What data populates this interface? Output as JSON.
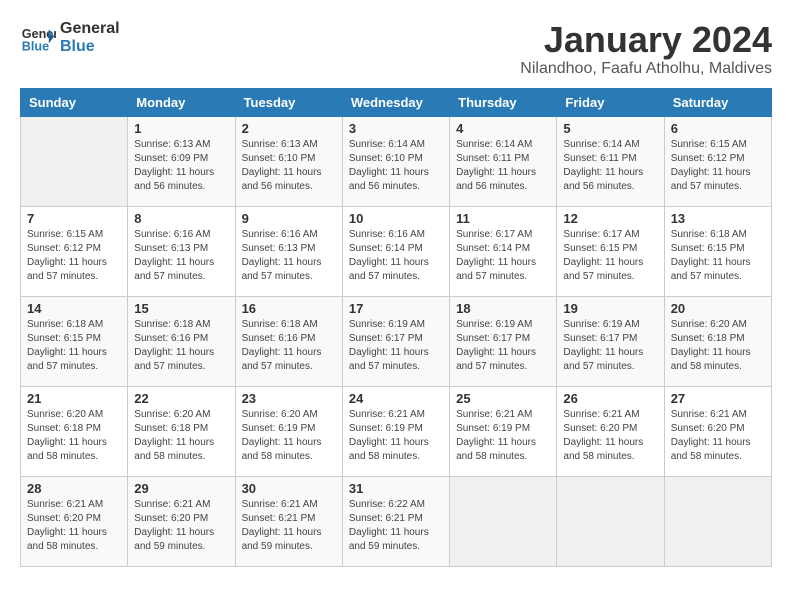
{
  "header": {
    "logo_line1": "General",
    "logo_line2": "Blue",
    "month": "January 2024",
    "location": "Nilandhoo, Faafu Atholhu, Maldives"
  },
  "weekdays": [
    "Sunday",
    "Monday",
    "Tuesday",
    "Wednesday",
    "Thursday",
    "Friday",
    "Saturday"
  ],
  "weeks": [
    [
      {
        "day": "",
        "info": ""
      },
      {
        "day": "1",
        "info": "Sunrise: 6:13 AM\nSunset: 6:09 PM\nDaylight: 11 hours\nand 56 minutes."
      },
      {
        "day": "2",
        "info": "Sunrise: 6:13 AM\nSunset: 6:10 PM\nDaylight: 11 hours\nand 56 minutes."
      },
      {
        "day": "3",
        "info": "Sunrise: 6:14 AM\nSunset: 6:10 PM\nDaylight: 11 hours\nand 56 minutes."
      },
      {
        "day": "4",
        "info": "Sunrise: 6:14 AM\nSunset: 6:11 PM\nDaylight: 11 hours\nand 56 minutes."
      },
      {
        "day": "5",
        "info": "Sunrise: 6:14 AM\nSunset: 6:11 PM\nDaylight: 11 hours\nand 56 minutes."
      },
      {
        "day": "6",
        "info": "Sunrise: 6:15 AM\nSunset: 6:12 PM\nDaylight: 11 hours\nand 57 minutes."
      }
    ],
    [
      {
        "day": "7",
        "info": "Sunrise: 6:15 AM\nSunset: 6:12 PM\nDaylight: 11 hours\nand 57 minutes."
      },
      {
        "day": "8",
        "info": "Sunrise: 6:16 AM\nSunset: 6:13 PM\nDaylight: 11 hours\nand 57 minutes."
      },
      {
        "day": "9",
        "info": "Sunrise: 6:16 AM\nSunset: 6:13 PM\nDaylight: 11 hours\nand 57 minutes."
      },
      {
        "day": "10",
        "info": "Sunrise: 6:16 AM\nSunset: 6:14 PM\nDaylight: 11 hours\nand 57 minutes."
      },
      {
        "day": "11",
        "info": "Sunrise: 6:17 AM\nSunset: 6:14 PM\nDaylight: 11 hours\nand 57 minutes."
      },
      {
        "day": "12",
        "info": "Sunrise: 6:17 AM\nSunset: 6:15 PM\nDaylight: 11 hours\nand 57 minutes."
      },
      {
        "day": "13",
        "info": "Sunrise: 6:18 AM\nSunset: 6:15 PM\nDaylight: 11 hours\nand 57 minutes."
      }
    ],
    [
      {
        "day": "14",
        "info": "Sunrise: 6:18 AM\nSunset: 6:15 PM\nDaylight: 11 hours\nand 57 minutes."
      },
      {
        "day": "15",
        "info": "Sunrise: 6:18 AM\nSunset: 6:16 PM\nDaylight: 11 hours\nand 57 minutes."
      },
      {
        "day": "16",
        "info": "Sunrise: 6:18 AM\nSunset: 6:16 PM\nDaylight: 11 hours\nand 57 minutes."
      },
      {
        "day": "17",
        "info": "Sunrise: 6:19 AM\nSunset: 6:17 PM\nDaylight: 11 hours\nand 57 minutes."
      },
      {
        "day": "18",
        "info": "Sunrise: 6:19 AM\nSunset: 6:17 PM\nDaylight: 11 hours\nand 57 minutes."
      },
      {
        "day": "19",
        "info": "Sunrise: 6:19 AM\nSunset: 6:17 PM\nDaylight: 11 hours\nand 57 minutes."
      },
      {
        "day": "20",
        "info": "Sunrise: 6:20 AM\nSunset: 6:18 PM\nDaylight: 11 hours\nand 58 minutes."
      }
    ],
    [
      {
        "day": "21",
        "info": "Sunrise: 6:20 AM\nSunset: 6:18 PM\nDaylight: 11 hours\nand 58 minutes."
      },
      {
        "day": "22",
        "info": "Sunrise: 6:20 AM\nSunset: 6:18 PM\nDaylight: 11 hours\nand 58 minutes."
      },
      {
        "day": "23",
        "info": "Sunrise: 6:20 AM\nSunset: 6:19 PM\nDaylight: 11 hours\nand 58 minutes."
      },
      {
        "day": "24",
        "info": "Sunrise: 6:21 AM\nSunset: 6:19 PM\nDaylight: 11 hours\nand 58 minutes."
      },
      {
        "day": "25",
        "info": "Sunrise: 6:21 AM\nSunset: 6:19 PM\nDaylight: 11 hours\nand 58 minutes."
      },
      {
        "day": "26",
        "info": "Sunrise: 6:21 AM\nSunset: 6:20 PM\nDaylight: 11 hours\nand 58 minutes."
      },
      {
        "day": "27",
        "info": "Sunrise: 6:21 AM\nSunset: 6:20 PM\nDaylight: 11 hours\nand 58 minutes."
      }
    ],
    [
      {
        "day": "28",
        "info": "Sunrise: 6:21 AM\nSunset: 6:20 PM\nDaylight: 11 hours\nand 58 minutes."
      },
      {
        "day": "29",
        "info": "Sunrise: 6:21 AM\nSunset: 6:20 PM\nDaylight: 11 hours\nand 59 minutes."
      },
      {
        "day": "30",
        "info": "Sunrise: 6:21 AM\nSunset: 6:21 PM\nDaylight: 11 hours\nand 59 minutes."
      },
      {
        "day": "31",
        "info": "Sunrise: 6:22 AM\nSunset: 6:21 PM\nDaylight: 11 hours\nand 59 minutes."
      },
      {
        "day": "",
        "info": ""
      },
      {
        "day": "",
        "info": ""
      },
      {
        "day": "",
        "info": ""
      }
    ]
  ]
}
